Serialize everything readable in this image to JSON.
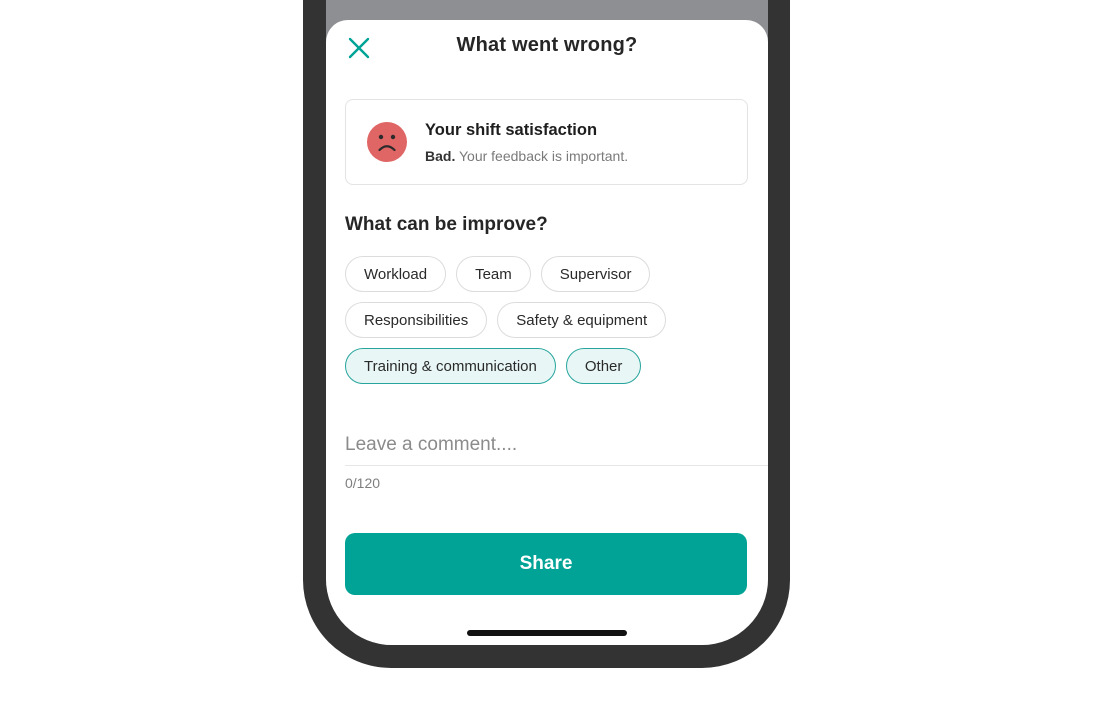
{
  "sheet": {
    "title": "What went wrong?",
    "close_icon": "close-x-icon"
  },
  "satisfaction": {
    "icon": "sad-face-icon",
    "title": "Your shift satisfaction",
    "rating": "Bad.",
    "message": "Your feedback is important."
  },
  "improve": {
    "heading": "What can be improve?",
    "chips": [
      {
        "label": "Workload",
        "selected": false
      },
      {
        "label": "Team",
        "selected": false
      },
      {
        "label": "Supervisor",
        "selected": false
      },
      {
        "label": "Responsibilities",
        "selected": false
      },
      {
        "label": "Safety & equipment",
        "selected": false
      },
      {
        "label": "Training & communication",
        "selected": true
      },
      {
        "label": "Other",
        "selected": true
      }
    ]
  },
  "comment": {
    "placeholder": "Leave a comment....",
    "value": "",
    "counter": "0/120"
  },
  "share_button": {
    "label": "Share"
  },
  "colors": {
    "accent": "#00a396",
    "chip_selected_bg": "#e8f7f6",
    "sad_face": "#e06565",
    "frame": "#333333"
  }
}
